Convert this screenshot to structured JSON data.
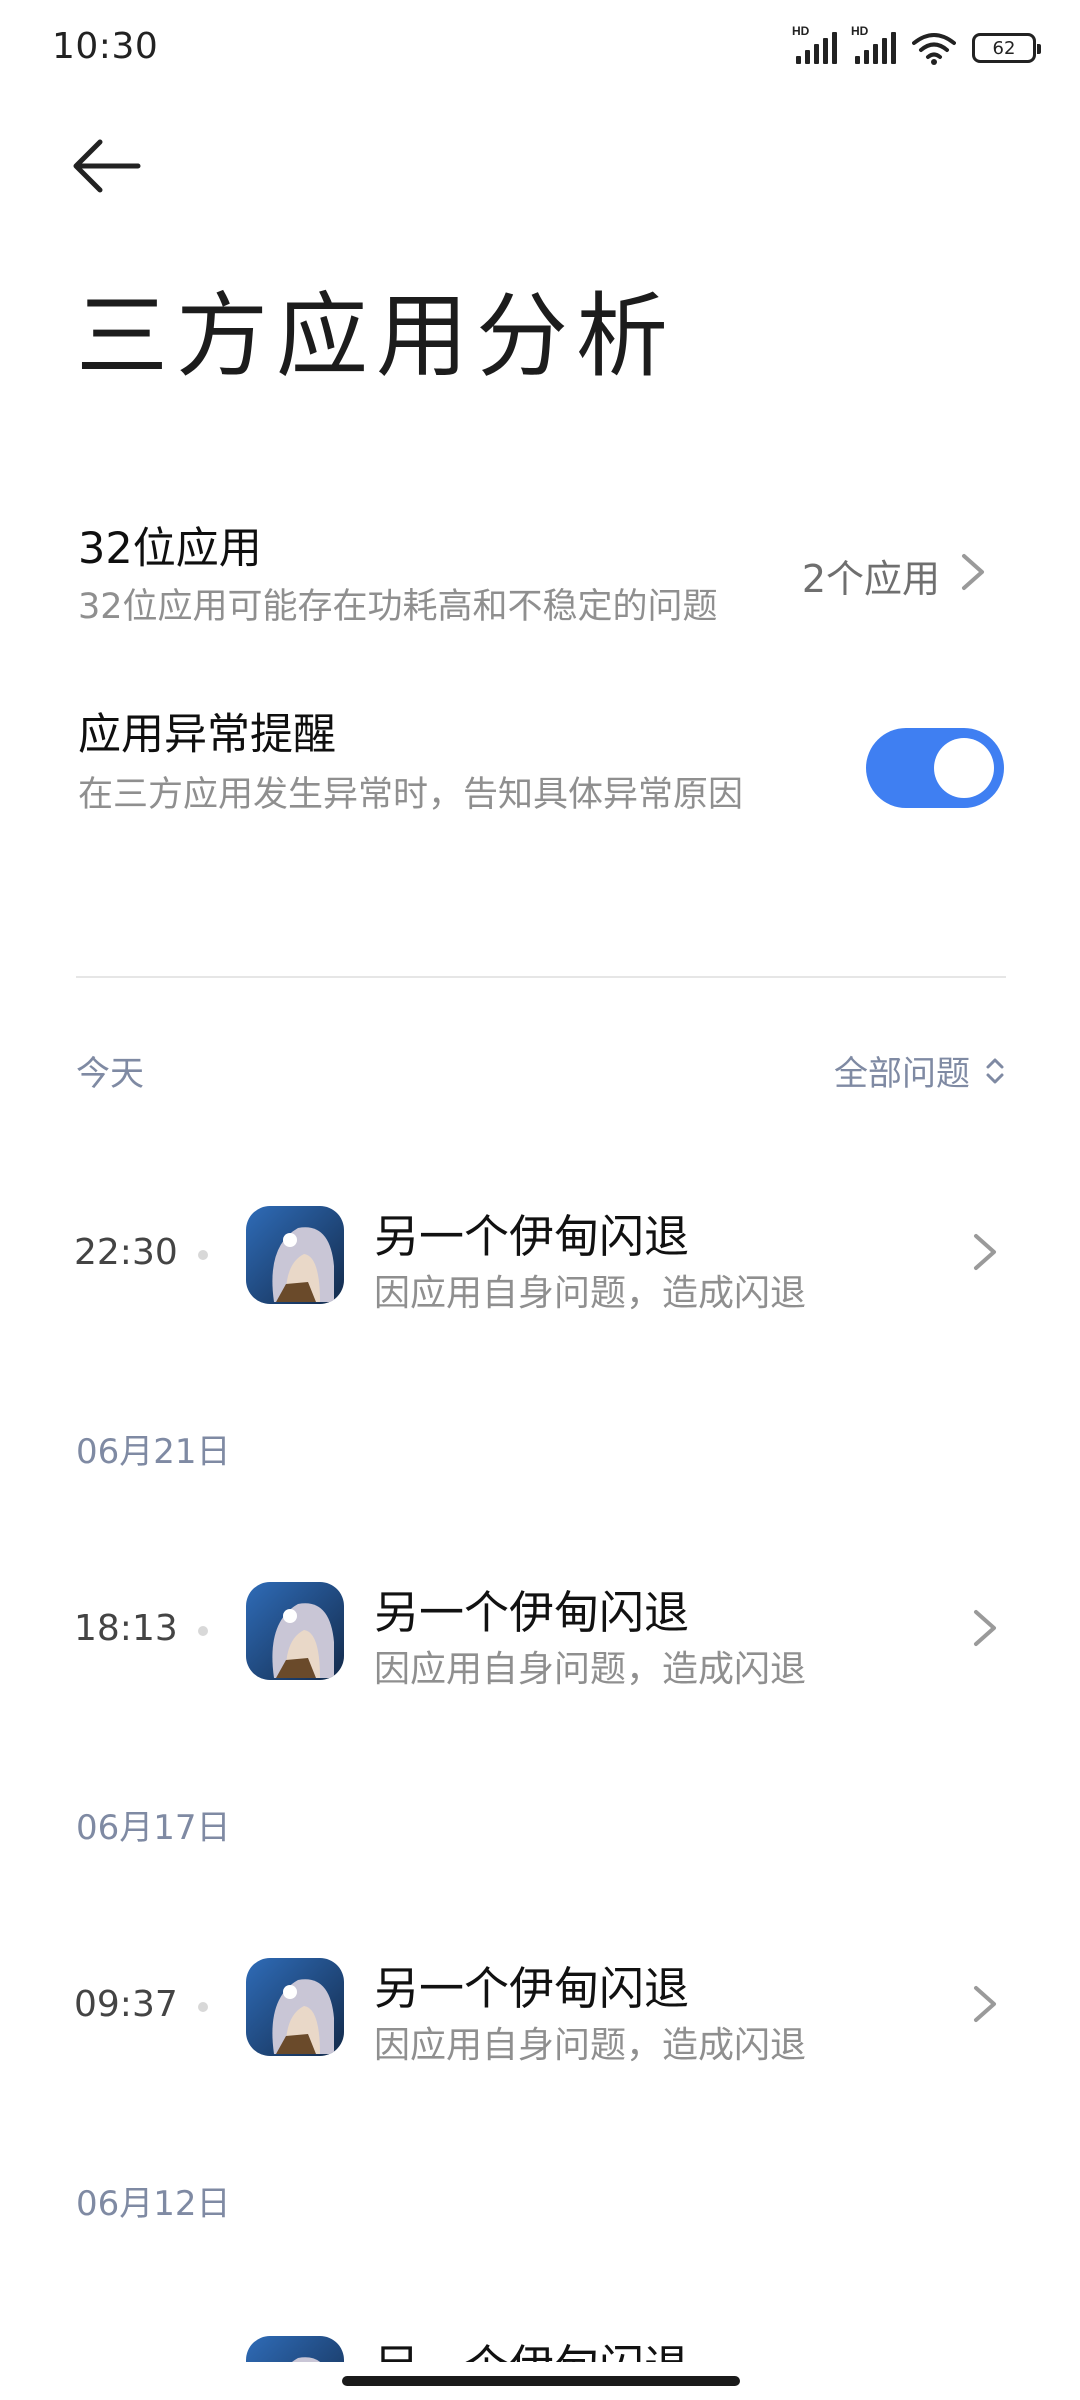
{
  "status_bar": {
    "time": "10:30",
    "battery": "62",
    "network_badge": "HD",
    "icons": [
      "signal-hd-icon",
      "signal-hd-icon",
      "wifi-icon",
      "battery-icon"
    ]
  },
  "header": {
    "back_icon": "arrow-left-icon",
    "title": "三方应用分析"
  },
  "settings": {
    "apps32": {
      "title": "32位应用",
      "subtitle": "32位应用可能存在功耗高和不稳定的问题",
      "value": "2个应用"
    },
    "anomaly_reminder": {
      "title": "应用异常提醒",
      "subtitle": "在三方应用发生异常时，告知具体异常原因",
      "enabled": true
    }
  },
  "filter": {
    "label": "全部问题"
  },
  "accent_color": "#3f7ff2",
  "groups": [
    {
      "date": "今天",
      "items": [
        {
          "time": "22:30",
          "title": "另一个伊甸闪退",
          "subtitle": "因应用自身问题，造成闪退"
        }
      ]
    },
    {
      "date": "06月21日",
      "items": [
        {
          "time": "18:13",
          "title": "另一个伊甸闪退",
          "subtitle": "因应用自身问题，造成闪退"
        }
      ]
    },
    {
      "date": "06月17日",
      "items": [
        {
          "time": "09:37",
          "title": "另一个伊甸闪退",
          "subtitle": "因应用自身问题，造成闪退"
        }
      ]
    },
    {
      "date": "06月12日",
      "items": [
        {
          "title": "另一个伊甸闪退"
        }
      ]
    }
  ]
}
